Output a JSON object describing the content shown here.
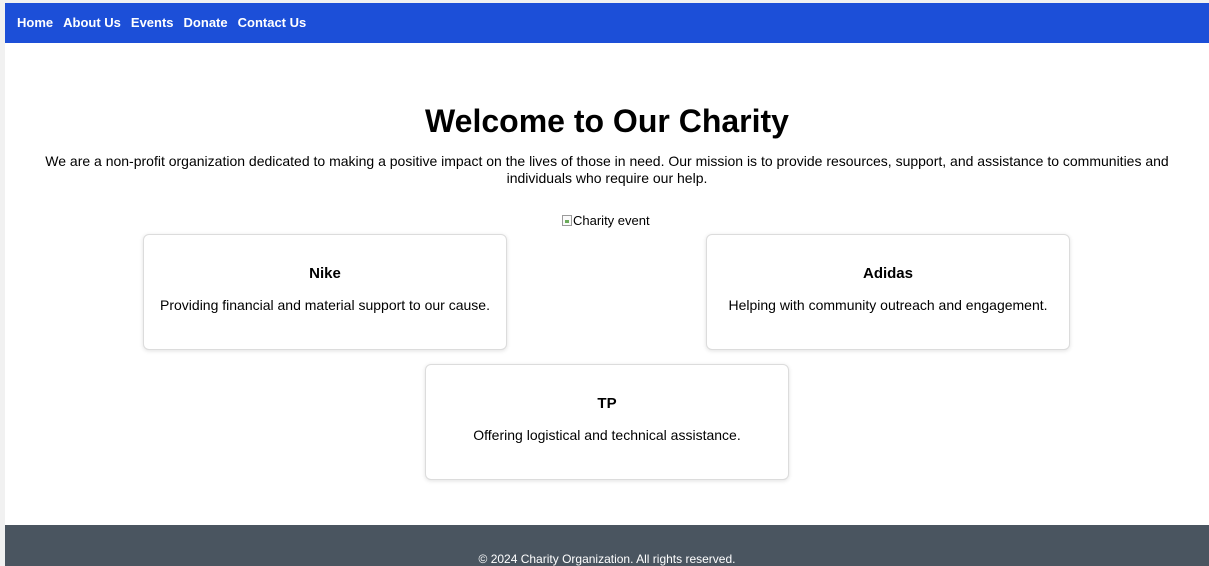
{
  "nav": {
    "items": [
      {
        "label": "Home"
      },
      {
        "label": "About Us"
      },
      {
        "label": "Events"
      },
      {
        "label": "Donate"
      },
      {
        "label": "Contact Us"
      }
    ]
  },
  "hero": {
    "title": "Welcome to Our Charity",
    "text": "We are a non-profit organization dedicated to making a positive impact on the lives of those in need. Our mission is to provide resources, support, and assistance to communities and individuals who require our help.",
    "image_alt": "Charity event"
  },
  "sponsors": [
    {
      "name": "Nike",
      "description": "Providing financial and material support to our cause."
    },
    {
      "name": "Adidas",
      "description": "Helping with community outreach and engagement."
    },
    {
      "name": "TP",
      "description": "Offering logistical and technical assistance."
    }
  ],
  "footer": {
    "text": "© 2024 Charity Organization. All rights reserved."
  },
  "colors": {
    "nav_bg": "#1c4fd8",
    "footer_bg": "#4a5560"
  }
}
